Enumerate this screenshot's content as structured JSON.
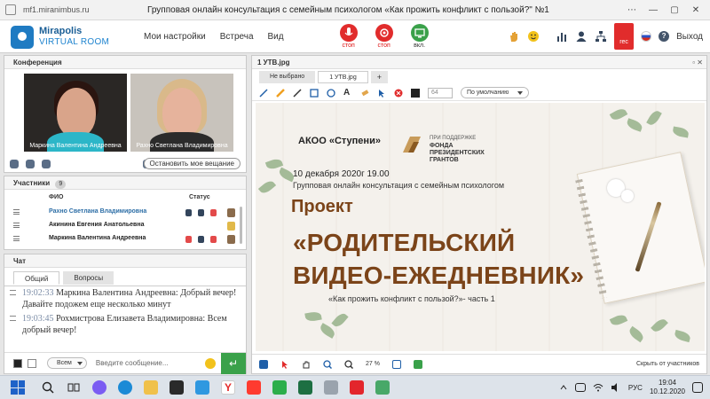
{
  "browser": {
    "url": "mf1.miranimbus.ru",
    "title": "Групповая онлайн консультация с семейным психологом «Как прожить конфликт с пользой?\" №1"
  },
  "app": {
    "brand_top": "Mirapolis",
    "brand_bottom": "VIRTUAL ROOM",
    "menu": [
      "Мои настройки",
      "Встреча",
      "Вид"
    ],
    "mic_label": "стоп",
    "cam_label": "стоп",
    "share_label": "вкл.",
    "rec_label": "rec",
    "exit_label": "Выход",
    "help_label": "?"
  },
  "conference": {
    "title": "Конференция",
    "videos": [
      {
        "name": "Маркина Валентина  Андреевна"
      },
      {
        "name": "Рахно Светлана  Владимировна"
      }
    ],
    "stop_button": "Остановить мое вещание"
  },
  "participants": {
    "title": "Участники",
    "count": "9",
    "col_name": "ФИО",
    "col_status": "Статус",
    "rows": [
      {
        "name": "Рахно Светлана  Владимировна",
        "active": true
      },
      {
        "name": "Акинина  Евгения Анатольевна",
        "active": false
      },
      {
        "name": "Маркина Валентина  Андреевна",
        "active": false
      }
    ]
  },
  "chat": {
    "title": "Чат",
    "tabs": [
      "Общий",
      "Вопросы"
    ],
    "messages": [
      {
        "time": "19:02:33",
        "author": "Маркина Валентина  Андреевна:",
        "text": "Добрый вечер! Давайте подожем еще несколько минут"
      },
      {
        "time": "19:03:45",
        "author": "Рохмистрова  Елизавета Владимировна:",
        "text": "Всем добрый вечер!"
      }
    ],
    "audience": "Всем",
    "input_placeholder": "Введите сообщение..."
  },
  "document": {
    "title": "1 УТВ.jpg",
    "window_buttons": "▫ ✕",
    "tabs": [
      "Не выбрано",
      "1 УТВ.jpg",
      "+"
    ],
    "size_value": "64",
    "font_dropdown": "По умолчанию",
    "zoom": "27",
    "zoom_unit": "%",
    "hide_label": "Скрыть от участников"
  },
  "slide": {
    "org": "АКОО «Ступени»",
    "fund_sub": "ПРИ ПОДДЕРЖКЕ",
    "fund_name": "ФОНДА ПРЕЗИДЕНТСКИХ ГРАНТОВ",
    "date": "10 декабря 2020г  19.00",
    "subtitle": "Групповая онлайн консультация с семейным психологом",
    "project": "Проект",
    "title_line1": "«РОДИТЕЛЬСКИЙ",
    "title_line2": "ВИДЕО-ЕЖЕДНЕВНИК»",
    "part": "«Как прожить конфликт с пользой?»- часть 1"
  },
  "taskbar": {
    "lang": "РУС",
    "time": "19:04",
    "date": "10.12.2020"
  },
  "colors": {
    "accent_blue": "#1f7bc2",
    "stop_red": "#e12c2c",
    "share_green": "#3aa14a",
    "slide_brown": "#7b4419"
  },
  "icons": [
    "lock-icon",
    "microphone-icon",
    "camera-icon",
    "screen-share-icon",
    "raise-hand-icon",
    "emoji-icon",
    "chart-icon",
    "user-icon",
    "network-icon",
    "send-icon",
    "pen-icon",
    "pointer-icon",
    "hand-icon",
    "zoom-in-icon",
    "zoom-out-icon",
    "fit-icon",
    "windows-start-icon",
    "search-icon",
    "task-view-icon"
  ]
}
